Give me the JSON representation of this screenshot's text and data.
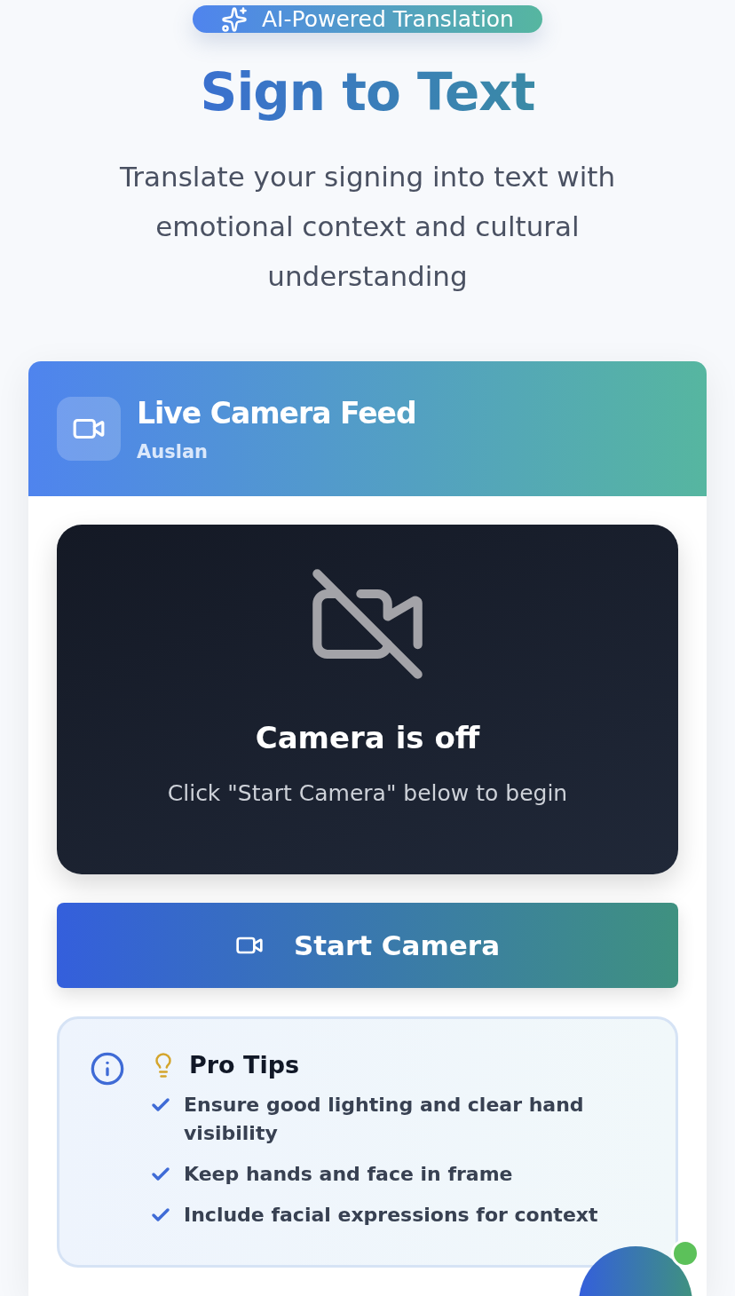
{
  "badge": {
    "label": "AI-Powered Translation"
  },
  "title": "Sign to Text",
  "subtitle": "Translate your signing into text with emotional context and cultural understanding",
  "camera_card": {
    "title": "Live Camera Feed",
    "language": "Auslan",
    "camera_on": false,
    "status_title": "Camera is off",
    "status_hint": "Click \"Start Camera\" below to begin",
    "button": "Start Camera"
  },
  "tips": {
    "title": "Pro Tips",
    "items": [
      "Ensure good lighting and clear hand visibility",
      "Keep hands and face in frame",
      "Include facial expressions for context"
    ]
  },
  "fab": {
    "online": true
  }
}
